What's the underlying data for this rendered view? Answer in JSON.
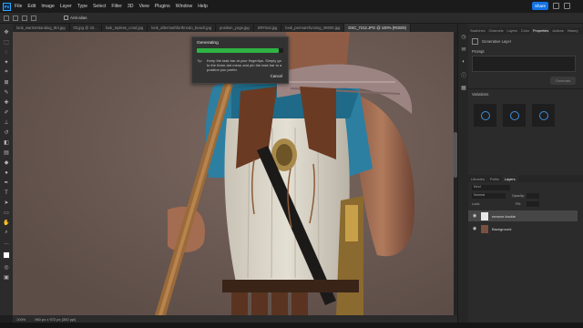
{
  "menu": {
    "app_logo": "Ps",
    "items": [
      "File",
      "Edit",
      "Image",
      "Layer",
      "Type",
      "Select",
      "Filter",
      "3D",
      "View",
      "Plugins",
      "Window",
      "Help"
    ],
    "share_label": "Share"
  },
  "options_bar": {
    "anti_alias_label": "Anti-alias"
  },
  "tabs": [
    {
      "label": "look_warriorstanding_8t4.jpg"
    },
    {
      "label": "03.jpg @ 33..."
    },
    {
      "label": "look_topless_cond.jpg"
    },
    {
      "label": "look_aftermathfurthnodo_beach.jpg"
    },
    {
      "label": "position_yoga.jpg"
    },
    {
      "label": "SRFinal.jpg"
    },
    {
      "label": "look_permanrfunning_08000.jpg"
    },
    {
      "label": "DSC_7212.JPG @ 100% (RGB/8)",
      "active": true
    }
  ],
  "generating_dialog": {
    "title": "Generating",
    "progress": 0.95,
    "tip_label": "Tip:",
    "tip_text": "Keep the task bar at your fingertips. Simply go to the three-dot menu and pin the task bar to a position you prefer.",
    "cancel_label": "Cancel"
  },
  "status_bar": {
    "zoom": "100%",
    "doc_info": "960 px x 972 px (300 ppi)"
  },
  "right_panel": {
    "tabs": [
      {
        "label": "Swatches"
      },
      {
        "label": "Channels"
      },
      {
        "label": "Layers"
      },
      {
        "label": "Color"
      },
      {
        "label": "Properties",
        "active": true
      },
      {
        "label": "Actions"
      },
      {
        "label": "History"
      }
    ],
    "properties_title": "Generative Layer",
    "prompt_label": "Prompt",
    "generate_label": "Generate",
    "variations_label": "Variations"
  },
  "layers_panel": {
    "tabs": [
      {
        "label": "Libraries"
      },
      {
        "label": "Paths"
      },
      {
        "label": "Layers",
        "active": true
      }
    ],
    "kind_label": "Kind",
    "mode_label": "Normal",
    "opacity_label": "Opacity:",
    "lock_label": "Lock:",
    "fill_label": "Fill:",
    "layers": [
      {
        "name": "remove buckle",
        "selected": true
      },
      {
        "name": "Background",
        "selected": false
      }
    ]
  },
  "colors": {
    "accent": "#1473e6",
    "progress_fill": "#2fb344",
    "backdrop": "#6f5e57",
    "cuirass": "#d8d3c7",
    "leather": "#6b3a22",
    "shirt": "#2c7fa1"
  },
  "icons": [
    "photoshop-logo",
    "move-tool-icon",
    "marquee-tool-icon",
    "lasso-tool-icon",
    "crop-tool-icon",
    "eyedropper-tool-icon",
    "healing-brush-icon",
    "brush-tool-icon",
    "clone-stamp-icon",
    "eraser-tool-icon",
    "gradient-tool-icon",
    "pen-tool-icon",
    "type-tool-icon",
    "hand-tool-icon",
    "zoom-tool-icon",
    "eye-icon",
    "layer-style-icon"
  ]
}
